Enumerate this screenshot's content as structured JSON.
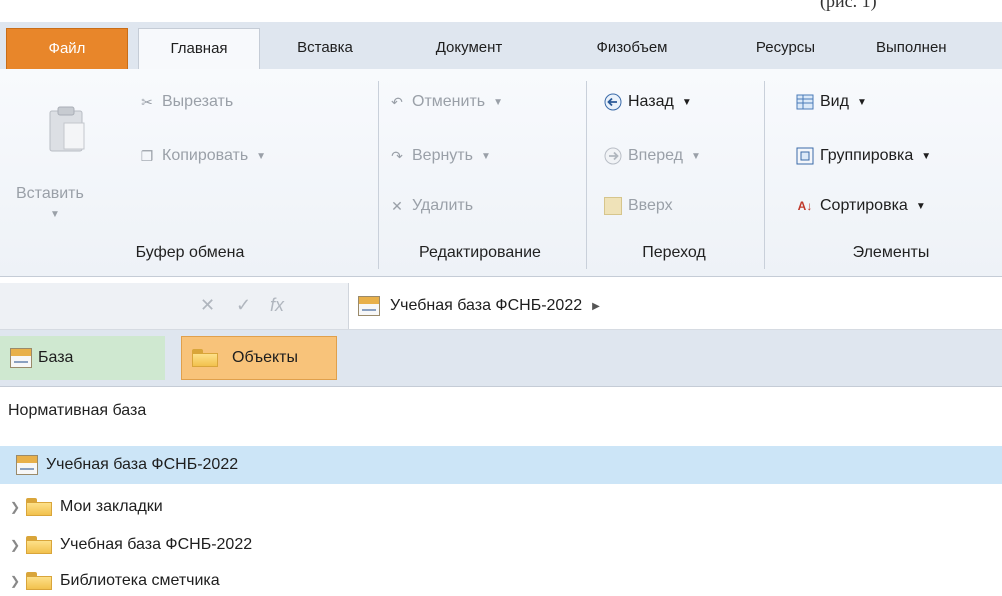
{
  "top_strip": {
    "fragment_left": "",
    "fragment_right": "(рис. 1)"
  },
  "tabs": [
    {
      "label": "Файл",
      "kind": "file"
    },
    {
      "label": "Главная",
      "kind": "active"
    },
    {
      "label": "Вставка",
      "kind": "normal"
    },
    {
      "label": "Документ",
      "kind": "normal"
    },
    {
      "label": "Физобъем",
      "kind": "normal"
    },
    {
      "label": "Ресурсы",
      "kind": "normal"
    },
    {
      "label": "Выполнен",
      "kind": "normal"
    }
  ],
  "ribbon": {
    "clipboard": {
      "paste": "Вставить",
      "cut": "Вырезать",
      "copy": "Копировать",
      "label": "Буфер обмена"
    },
    "editing": {
      "undo": "Отменить",
      "redo": "Вернуть",
      "delete": "Удалить",
      "label": "Редактирование"
    },
    "navigation": {
      "back": "Назад",
      "forward": "Вперед",
      "up": "Вверх",
      "label": "Переход"
    },
    "elements": {
      "view": "Вид",
      "grouping": "Группировка",
      "sorting": "Сортировка",
      "label": "Элементы"
    }
  },
  "breadcrumb": {
    "label": "Учебная база ФСНБ-2022"
  },
  "view_tabs": {
    "base": "База",
    "objects": "Объекты"
  },
  "tree": {
    "title": "Нормативная база",
    "selected": "Учебная база ФСНБ-2022",
    "items": [
      "Мои закладки",
      "Учебная база ФСНБ-2022",
      "Библиотека сметчика"
    ]
  },
  "colors": {
    "file_tab": "#e8862a",
    "objects_tab": "#f8c37a",
    "base_tab": "#cfe8d0",
    "selected_row": "#cce5f7"
  }
}
